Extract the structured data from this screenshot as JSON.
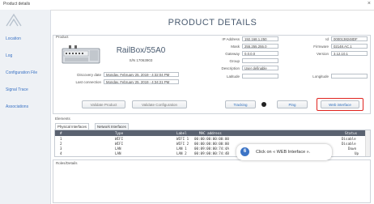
{
  "window": {
    "title": "Product details",
    "close_glyph": "×"
  },
  "sidebar": {
    "items": [
      {
        "label": "Location"
      },
      {
        "label": "Log"
      },
      {
        "label": "Configuration File"
      },
      {
        "label": "Signal Trace"
      },
      {
        "label": "Associations"
      }
    ]
  },
  "page_title": "PRODUCT DETAILS",
  "product": {
    "group_label": "Product",
    "name": "RailBox/55A0",
    "serial": "S/N 17063903",
    "discovery_label": "Discovery date",
    "discovery_value": "Monday, February 25, 2019 - 4:32:04 PM",
    "last_conn_label": "Last connection",
    "last_conn_value": "Monday, February 25, 2019 - 4:34:21 PM",
    "fields": {
      "ip_label": "IP Address",
      "ip_value": "192.168.1.250",
      "mask_label": "Mask",
      "mask_value": "255.255.255.0",
      "gateway_label": "Gateway",
      "gateway_value": "0.0.0.0",
      "group_label": "Group",
      "group_value": "",
      "desc_label": "Description",
      "desc_value": "User definable",
      "lat_label": "Latitude",
      "lat_value": "",
      "id_label": "Id",
      "id_value": "0000138248DF",
      "fw_label": "Firmware",
      "fw_value": "02148.AC.1",
      "ver_label": "Version",
      "ver_value": "3.12.10.1",
      "long_label": "Longitude",
      "long_value": ""
    },
    "buttons": {
      "validate_product": "Validate Product",
      "validate_config": "Validate Configuration",
      "tracking": "Tracking",
      "ping": "Ping",
      "web_interface": "Web interface"
    }
  },
  "elements": {
    "group_label": "Elements",
    "tabs": [
      "Physical Interfaces",
      "Network Interfaces"
    ],
    "columns": [
      "#",
      "Type",
      "Label",
      "MAC address",
      "Status"
    ],
    "rows": [
      [
        "1",
        "WIFI",
        "WIFI 1",
        "00:00:00:00:00:00",
        "Disable"
      ],
      [
        "2",
        "WIFI",
        "WIFI 2",
        "00:00:00:00:00:00",
        "Disable"
      ],
      [
        "3",
        "LAN",
        "LAN 1",
        "00:09:00:00:74:4A",
        "Down"
      ],
      [
        "4",
        "LAN",
        "LAN 2",
        "00:09:00:00:74:4B",
        "Up"
      ]
    ]
  },
  "roles": {
    "group_label": "Roles/Details"
  },
  "callout": {
    "number": "6",
    "text": "Click on « WEB Interface »."
  },
  "colors": {
    "accent": "#3c74c6",
    "highlight": "#e0241f"
  }
}
